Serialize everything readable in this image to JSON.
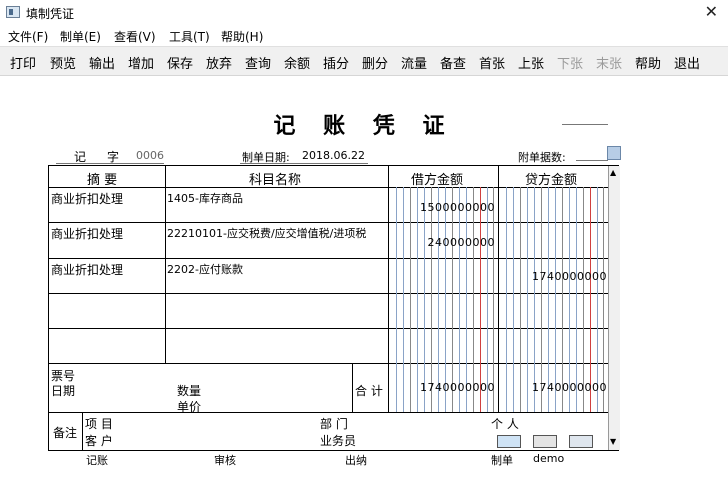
{
  "window": {
    "title": "填制凭证",
    "close": "✕"
  },
  "menu": [
    "文件(F)",
    "制单(E)",
    "查看(V)",
    "工具(T)",
    "帮助(H)"
  ],
  "toolbar": {
    "print": "打印",
    "preview": "预览",
    "export": "输出",
    "add": "增加",
    "save": "保存",
    "discard": "放弃",
    "query": "查询",
    "balance": "余额",
    "insert": "插分",
    "delete": "删分",
    "flow": "流量",
    "memo": "备查",
    "first": "首张",
    "prev": "上张",
    "next": "下张",
    "last": "末张",
    "help": "帮助",
    "exit": "退出"
  },
  "voucher": {
    "title": "记 账 凭 证",
    "type_char": "记",
    "zi": "字",
    "number": "0006",
    "date_label": "制单日期:",
    "date": "2018.06.22",
    "attach_label": "附单据数:",
    "headers": {
      "summary": "摘 要",
      "account": "科目名称",
      "debit": "借方金额",
      "credit": "贷方金额"
    },
    "rows": [
      {
        "summary": "商业折扣处理",
        "account": "1405-库存商品",
        "debit": "1500000000",
        "credit": ""
      },
      {
        "summary": "商业折扣处理",
        "account": "22210101-应交税费/应交增值税/进项税",
        "debit": "240000000",
        "credit": ""
      },
      {
        "summary": "商业折扣处理",
        "account": "2202-应付账款",
        "debit": "",
        "credit": "1740000000"
      },
      {
        "summary": "",
        "account": "",
        "debit": "",
        "credit": ""
      },
      {
        "summary": "",
        "account": "",
        "debit": "",
        "credit": ""
      }
    ],
    "bill_no": "票号",
    "date_sub": "日期",
    "qty": "数量",
    "price": "单价",
    "total_label": "合 计",
    "total_debit": "1740000000",
    "total_credit": "1740000000",
    "remark": "备注",
    "project": "项 目",
    "dept": "部 门",
    "person": "个 人",
    "customer": "客 户",
    "salesman": "业务员"
  },
  "footer": {
    "bookkeep": "记账",
    "audit": "审核",
    "cashier": "出纳",
    "maker_label": "制单",
    "maker": "demo"
  }
}
